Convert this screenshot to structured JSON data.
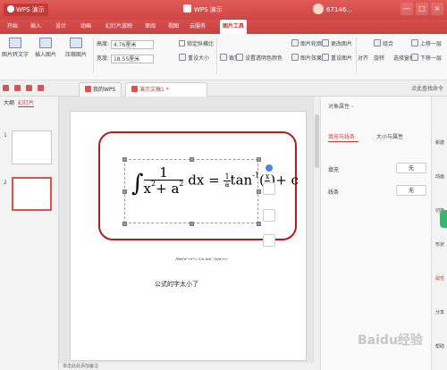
{
  "titlebar": {
    "app_name": "WPS 演示",
    "doc_title": "WPS 演示",
    "user": "67146...",
    "win_min": "—",
    "win_max": "□",
    "win_close": "×"
  },
  "menu": [
    "开始",
    "插入",
    "设计",
    "动画",
    "幻灯片放映",
    "审阅",
    "视图",
    "云服务",
    "图片工具"
  ],
  "ribbon": {
    "big": [
      "图片转文字",
      "插入图片",
      "压缩图片"
    ],
    "height_label": "高度:",
    "height_value": "4.76厘米",
    "width_label": "宽度:",
    "width_value": "18.55厘米",
    "lock_ratio": "锁定纵横比",
    "reset_size": "重设大小",
    "crop": "裁剪",
    "transparent": "设置透明色",
    "color": "颜色",
    "outline": "图片轮廓",
    "effects": "图片效果",
    "change_pic": "更改图片",
    "reset_pic": "重设图片",
    "arrange": "对齐",
    "rotate": "旋转",
    "group": "组合",
    "select_pane": "选择窗格",
    "up": "上移一层",
    "down": "下移一层"
  },
  "tabs": [
    {
      "label": "我的WPS"
    },
    {
      "label": "演示文稿1 *"
    }
  ],
  "tabs_right": "点此查找命令",
  "leftpanel": {
    "tab_outline": "大纲",
    "tab_slides": "幻灯片",
    "slide1": "1",
    "slide2": "2"
  },
  "slide": {
    "formula": {
      "int": "∫",
      "num": "1",
      "den_x": "x",
      "den_sup1": "2",
      "den_plus": "+ a",
      "den_sup2": "2",
      "dx": "dx =",
      "c_num": "1",
      "c_den": "a",
      "tan": "tan",
      "tan_sup": "-1",
      "x_num": "x",
      "x_den": "a",
      "tail": "+ c"
    },
    "small_formula": "∫dx/(x²+a²)=1/a tan⁻¹(x/a)+c",
    "caption": "公式的字太小了"
  },
  "props": {
    "title": "对象属性 -",
    "tab_fill": "填充与线条",
    "tab_size": "大小与属性",
    "fill_label": "填充",
    "fill_value": "无",
    "line_label": "线条",
    "line_value": "无"
  },
  "sidebar": [
    "新建",
    "动画",
    "切换",
    "形状",
    "属性",
    "分享",
    "帮助"
  ],
  "status": "单击此处添加备注",
  "watermark": "Baidu经验"
}
